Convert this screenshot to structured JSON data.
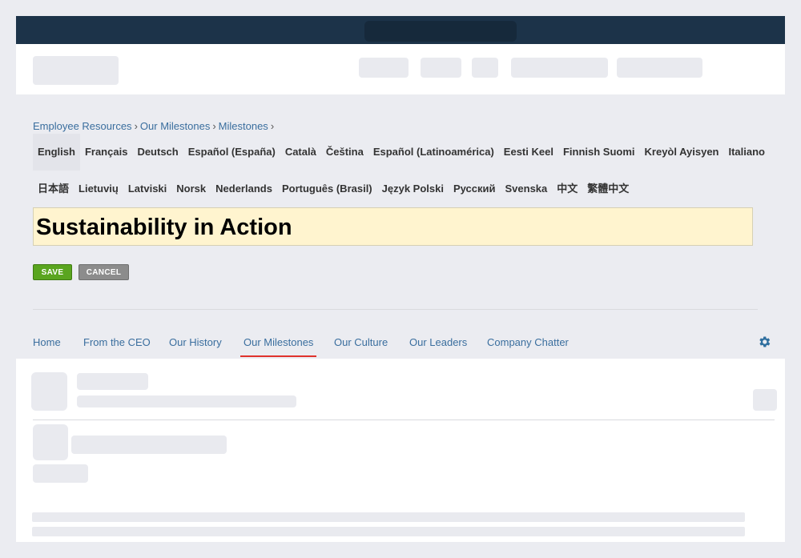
{
  "breadcrumb": {
    "items": [
      "Employee Resources",
      "Our Milestones",
      "Milestones"
    ],
    "separator": "›"
  },
  "languages": {
    "row1": [
      "English",
      "Français",
      "Deutsch",
      "Español (España)",
      "Català",
      "Čeština",
      "Español (Latinoamérica)",
      "Eesti Keel",
      "Finnish Suomi",
      "Kreyòl Ayisyen",
      "Italiano"
    ],
    "row2": [
      "日本語",
      "Lietuvių",
      "Latviski",
      "Norsk",
      "Nederlands",
      "Português (Brasil)",
      "Język Polski",
      "Русский",
      "Svenska",
      "中文",
      "繁體中文"
    ],
    "selected": "English"
  },
  "editor": {
    "title_value": "Sustainability in Action",
    "save_label": "SAVE",
    "cancel_label": "CANCEL"
  },
  "nav": {
    "tabs": [
      "Home",
      "From the CEO",
      "Our History",
      "Our Milestones",
      "Our Culture",
      "Our Leaders",
      "Company Chatter"
    ],
    "active": "Our Milestones",
    "settings_icon": "gear-icon"
  },
  "colors": {
    "topbar": "#1c3349",
    "link": "#3a6e9e",
    "save": "#5aa51f",
    "cancel": "#8c8c8c",
    "title_bg": "#fff4cf",
    "active_tab_underline": "#e0332c"
  }
}
